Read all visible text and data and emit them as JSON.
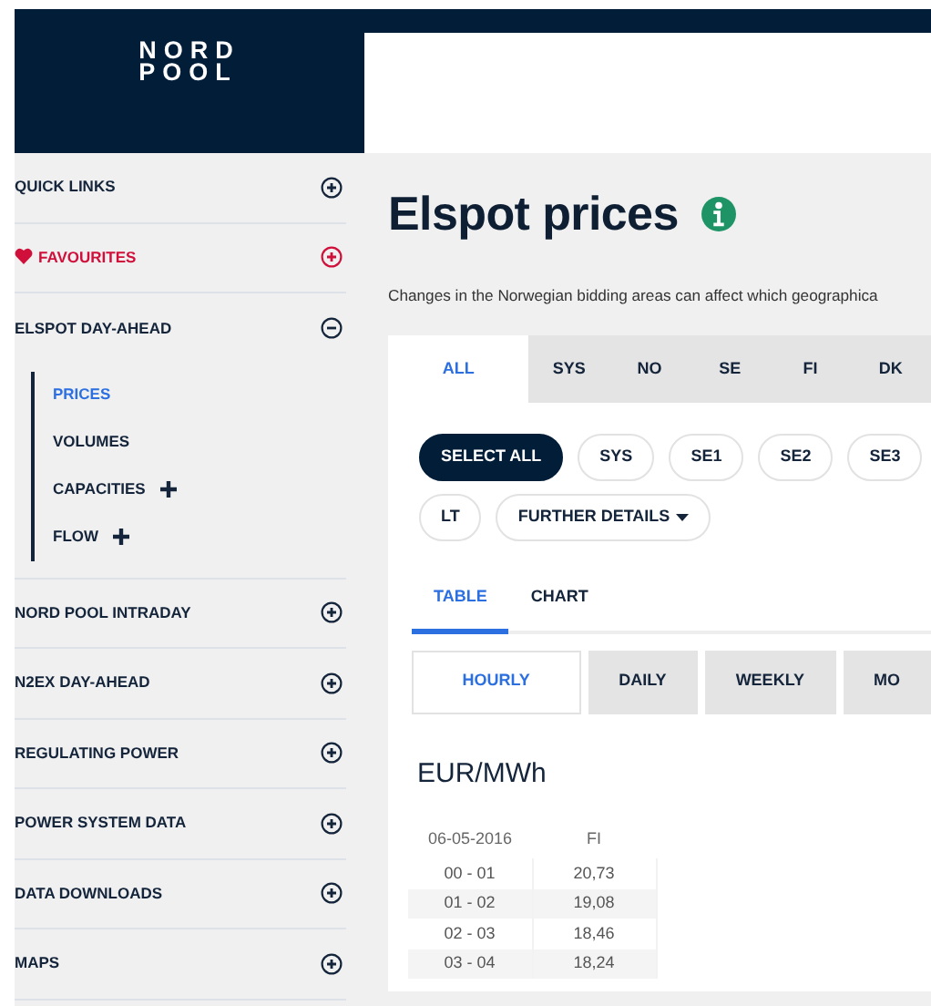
{
  "logo": {
    "line_1": "NORD",
    "line_2": "POOL"
  },
  "sidebar": {
    "items": [
      {
        "label": "QUICK LINKS",
        "kind": "section",
        "expanded": false
      },
      {
        "label": "FAVOURITES",
        "kind": "favourites",
        "expanded": false
      },
      {
        "label": "ELSPOT DAY-AHEAD",
        "kind": "section",
        "expanded": true,
        "children": [
          {
            "label": "PRICES",
            "selected": true,
            "has_submenu": false
          },
          {
            "label": "VOLUMES",
            "selected": false,
            "has_submenu": false
          },
          {
            "label": "CAPACITIES",
            "selected": false,
            "has_submenu": true
          },
          {
            "label": "FLOW",
            "selected": false,
            "has_submenu": true
          }
        ]
      },
      {
        "label": "NORD POOL INTRADAY",
        "kind": "section",
        "expanded": false
      },
      {
        "label": "N2EX DAY-AHEAD",
        "kind": "section",
        "expanded": false
      },
      {
        "label": "REGULATING POWER",
        "kind": "section",
        "expanded": false
      },
      {
        "label": "POWER SYSTEM DATA",
        "kind": "section",
        "expanded": false
      },
      {
        "label": "DATA DOWNLOADS",
        "kind": "section",
        "expanded": false
      },
      {
        "label": "MAPS",
        "kind": "section",
        "expanded": false
      }
    ]
  },
  "page": {
    "title": "Elspot prices",
    "description": "Changes in the Norwegian bidding areas can affect which geographica"
  },
  "area_tabs": [
    {
      "label": "ALL",
      "selected": true
    },
    {
      "label": "SYS",
      "selected": false
    },
    {
      "label": "NO",
      "selected": false
    },
    {
      "label": "SE",
      "selected": false
    },
    {
      "label": "FI",
      "selected": false
    },
    {
      "label": "DK",
      "selected": false
    }
  ],
  "area_filters": [
    {
      "label": "SELECT ALL",
      "kind": "pill",
      "selected": true
    },
    {
      "label": "SYS",
      "kind": "pill",
      "selected": false
    },
    {
      "label": "SE1",
      "kind": "pill",
      "selected": false
    },
    {
      "label": "SE2",
      "kind": "pill",
      "selected": false
    },
    {
      "label": "SE3",
      "kind": "pill",
      "selected": false
    },
    {
      "label": "LT",
      "kind": "pill",
      "selected": false
    },
    {
      "label": "FURTHER DETAILS",
      "kind": "dropdown",
      "selected": false
    }
  ],
  "view_tabs": [
    {
      "label": "TABLE",
      "selected": true
    },
    {
      "label": "CHART",
      "selected": false
    }
  ],
  "period_tabs": [
    {
      "label": "HOURLY",
      "selected": true
    },
    {
      "label": "DAILY",
      "selected": false
    },
    {
      "label": "WEEKLY",
      "selected": false
    },
    {
      "label": "MO",
      "selected": false
    }
  ],
  "unit": "EUR/MWh",
  "table": {
    "columns": [
      "06-05-2016",
      "FI"
    ],
    "rows": [
      [
        "00 - 01",
        "20,73"
      ],
      [
        "01 - 02",
        "19,08"
      ],
      [
        "02 - 03",
        "18,46"
      ],
      [
        "03 - 04",
        "18,24"
      ]
    ]
  }
}
